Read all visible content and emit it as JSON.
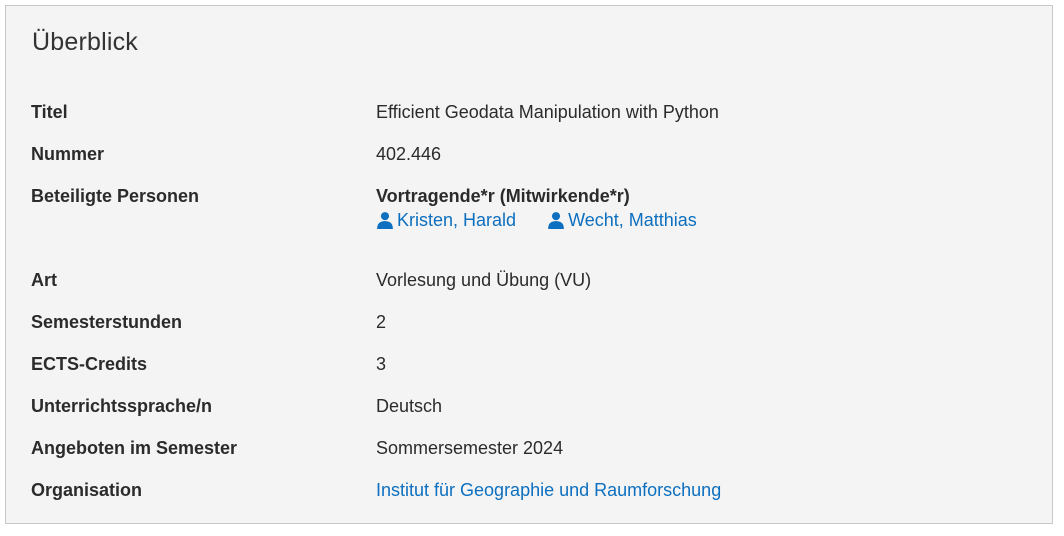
{
  "panel": {
    "title": "Überblick",
    "rows": [
      {
        "label": "Titel",
        "value": "Efficient Geodata Manipulation with Python"
      },
      {
        "label": "Nummer",
        "value": "402.446"
      },
      {
        "label": "Beteiligte Personen",
        "role": "Vortragende*r (Mitwirkende*r)",
        "persons": [
          "Kristen, Harald",
          "Wecht, Matthias"
        ]
      },
      {
        "label": "Art",
        "value": "Vorlesung und Übung (VU)"
      },
      {
        "label": "Semesterstunden",
        "value": "2"
      },
      {
        "label": "ECTS-Credits",
        "value": "3"
      },
      {
        "label": "Unterrichtssprache/n",
        "value": "Deutsch"
      },
      {
        "label": "Angeboten im Semester",
        "value": "Sommersemester 2024"
      },
      {
        "label": "Organisation",
        "value": "Institut für Geographie und Raumforschung"
      }
    ]
  },
  "colors": {
    "link": "#0d6fbf",
    "panel_bg": "#f4f4f4",
    "border": "#c8c8c8"
  },
  "icons": {
    "person": "user-icon"
  }
}
